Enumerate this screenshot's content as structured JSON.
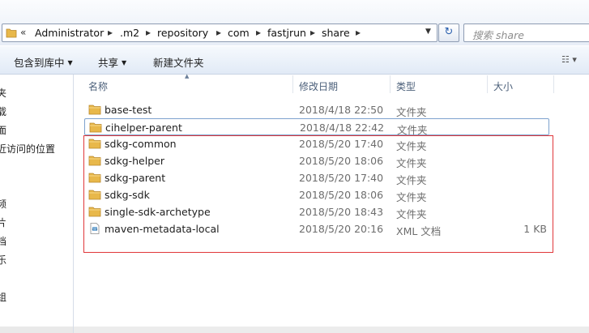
{
  "address_bar": {
    "overflow_chevron": "«",
    "breadcrumbs": [
      "Administrator",
      ".m2",
      "repository",
      "com",
      "fastjrun",
      "share"
    ],
    "dropdown_glyph": "▼",
    "refresh_glyph": "↻"
  },
  "search": {
    "placeholder": "搜索 share"
  },
  "toolbar": {
    "include_in_library": "包含到库中",
    "share": "共享",
    "new_folder": "新建文件夹",
    "view_glyph": "☷ ▾"
  },
  "nav_pane": {
    "items": [
      "夹",
      "载",
      "面",
      "近访问的位置",
      "频",
      "片",
      "档",
      "乐",
      "组"
    ]
  },
  "columns": {
    "name": "名称",
    "date_modified": "修改日期",
    "type": "类型",
    "size": "大小"
  },
  "files": [
    {
      "name": "base-test",
      "date": "2018/4/18 22:50",
      "type": "文件夹",
      "size": "",
      "icon": "folder-icon"
    },
    {
      "name": "cihelper-parent",
      "date": "2018/4/18 22:42",
      "type": "文件夹",
      "size": "",
      "icon": "folder-icon"
    },
    {
      "name": "sdkg-common",
      "date": "2018/5/20 17:40",
      "type": "文件夹",
      "size": "",
      "icon": "folder-icon"
    },
    {
      "name": "sdkg-helper",
      "date": "2018/5/20 18:06",
      "type": "文件夹",
      "size": "",
      "icon": "folder-icon"
    },
    {
      "name": "sdkg-parent",
      "date": "2018/5/20 17:40",
      "type": "文件夹",
      "size": "",
      "icon": "folder-icon"
    },
    {
      "name": "sdkg-sdk",
      "date": "2018/5/20 18:06",
      "type": "文件夹",
      "size": "",
      "icon": "folder-icon"
    },
    {
      "name": "single-sdk-archetype",
      "date": "2018/5/20 18:43",
      "type": "文件夹",
      "size": "",
      "icon": "folder-icon"
    },
    {
      "name": "maven-metadata-local",
      "date": "2018/5/20 20:16",
      "type": "XML 文档",
      "size": "1 KB",
      "icon": "xml-file-icon"
    }
  ],
  "colors": {
    "highlight_box": "#e0373a",
    "focus_border": "#7da2ce",
    "folder": "#e8b84a"
  }
}
